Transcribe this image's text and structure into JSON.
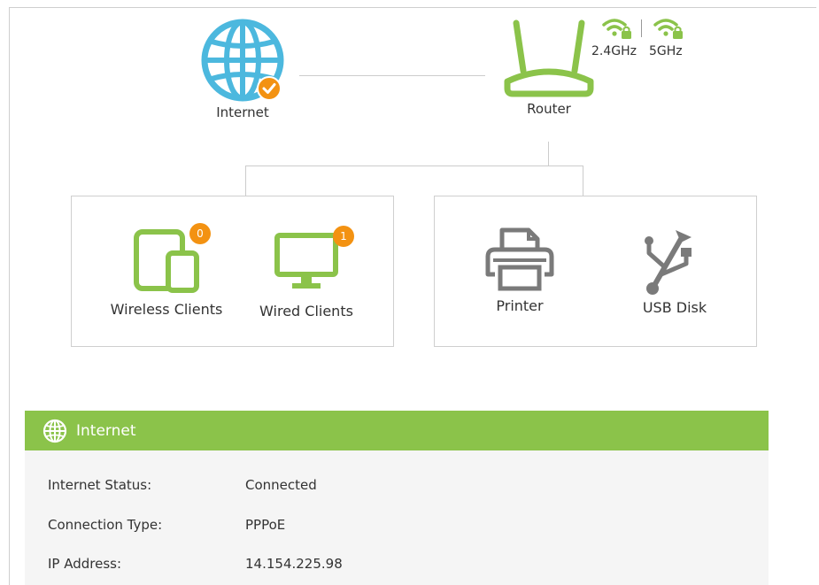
{
  "topology": {
    "internet": {
      "label": "Internet",
      "icon": "globe-icon",
      "status_icon": "check-icon"
    },
    "router": {
      "label": "Router",
      "icon": "router-icon"
    },
    "bands": [
      {
        "label": "2.4GHz",
        "icon": "wifi-lock-icon"
      },
      {
        "label": "5GHz",
        "icon": "wifi-lock-icon"
      }
    ]
  },
  "clients": {
    "wireless": {
      "label": "Wireless Clients",
      "count": "0"
    },
    "wired": {
      "label": "Wired Clients",
      "count": "1"
    }
  },
  "usb_devices": {
    "printer": {
      "label": "Printer"
    },
    "usb_disk": {
      "label": "USB Disk"
    }
  },
  "internet_panel": {
    "title": "Internet",
    "rows": [
      {
        "key": "Internet Status:",
        "value": "Connected"
      },
      {
        "key": "Connection Type:",
        "value": "PPPoE"
      },
      {
        "key": "IP Address:",
        "value": "14.154.225.98"
      }
    ]
  },
  "colors": {
    "accent_green": "#8bc34a",
    "globe_blue": "#4cb8de",
    "badge_orange": "#f39212",
    "device_gray": "#7a7a7a"
  }
}
